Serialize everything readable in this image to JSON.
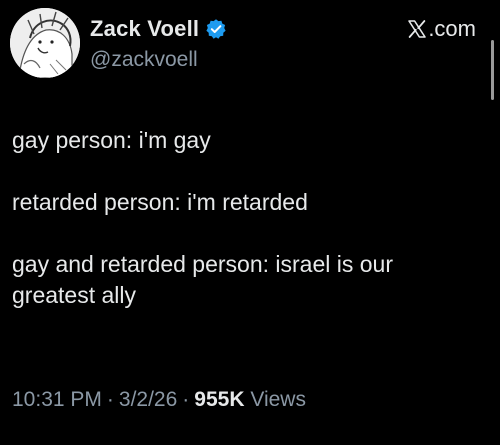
{
  "header": {
    "display_name": "Zack Voell",
    "handle": "@zackvoell",
    "site": ".com",
    "verified": true
  },
  "tweet": {
    "lines": [
      "gay person: i'm gay",
      "retarded person: i'm retarded",
      "gay and retarded person: israel is our",
      "greatest ally"
    ]
  },
  "meta": {
    "time": "10:31 PM",
    "separator": "·",
    "date": "3/2/26",
    "views_count": "955K",
    "views_label": "Views"
  },
  "colors": {
    "background": "#000000",
    "text": "#e7e9ea",
    "secondary_text": "#8b98a5",
    "verified_blue": "#1d9bf0"
  },
  "icons": {
    "verified": "verified-badge-icon",
    "site_logo": "x-logo-icon"
  }
}
